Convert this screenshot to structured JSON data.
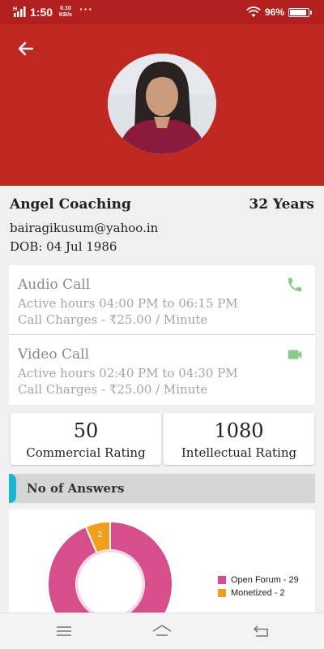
{
  "status_bar": {
    "network": "H",
    "time": "1:50",
    "speed_value": "0.10",
    "speed_unit": "KB/s",
    "dots": "···",
    "battery_text": "96%",
    "battery_level": 0.96
  },
  "header": {
    "background": "#c0271f",
    "back_icon": "arrow-left-icon"
  },
  "profile": {
    "name": "Angel Coaching",
    "age": "32 Years",
    "email": "bairagikusum@yahoo.in",
    "dob": "DOB: 04 Jul 1986"
  },
  "calls": [
    {
      "title": "Audio Call",
      "hours": "Active hours 04:00 PM to 06:15 PM",
      "charges": "Call Charges - ₹25.00 / Minute",
      "icon": "phone-icon"
    },
    {
      "title": "Video Call",
      "hours": "Active hours 02:40 PM to 04:30 PM",
      "charges": "Call Charges - ₹25.00 / Minute",
      "icon": "video-camera-icon"
    }
  ],
  "ratings": [
    {
      "value": "50",
      "label": "Commercial Rating"
    },
    {
      "value": "1080",
      "label": "Intellectual Rating"
    }
  ],
  "answers_section": {
    "title": "No of Answers"
  },
  "chart_data": {
    "type": "pie",
    "donut": true,
    "categories": [
      "Open Forum",
      "Monetized"
    ],
    "values": [
      29,
      2
    ],
    "colors": [
      "#d64f8c",
      "#f29d1b"
    ],
    "data_labels": [
      "",
      "2"
    ],
    "legend": [
      "Open Forum - 29",
      "Monetized - 2"
    ],
    "legend_placement": "right"
  },
  "colors": {
    "accent_call_icon": "#86c98a",
    "section_accent": "#1bb4d6"
  },
  "nav": {
    "menu_icon": "menu-icon",
    "home_icon": "home-icon",
    "back_icon": "back-icon"
  }
}
